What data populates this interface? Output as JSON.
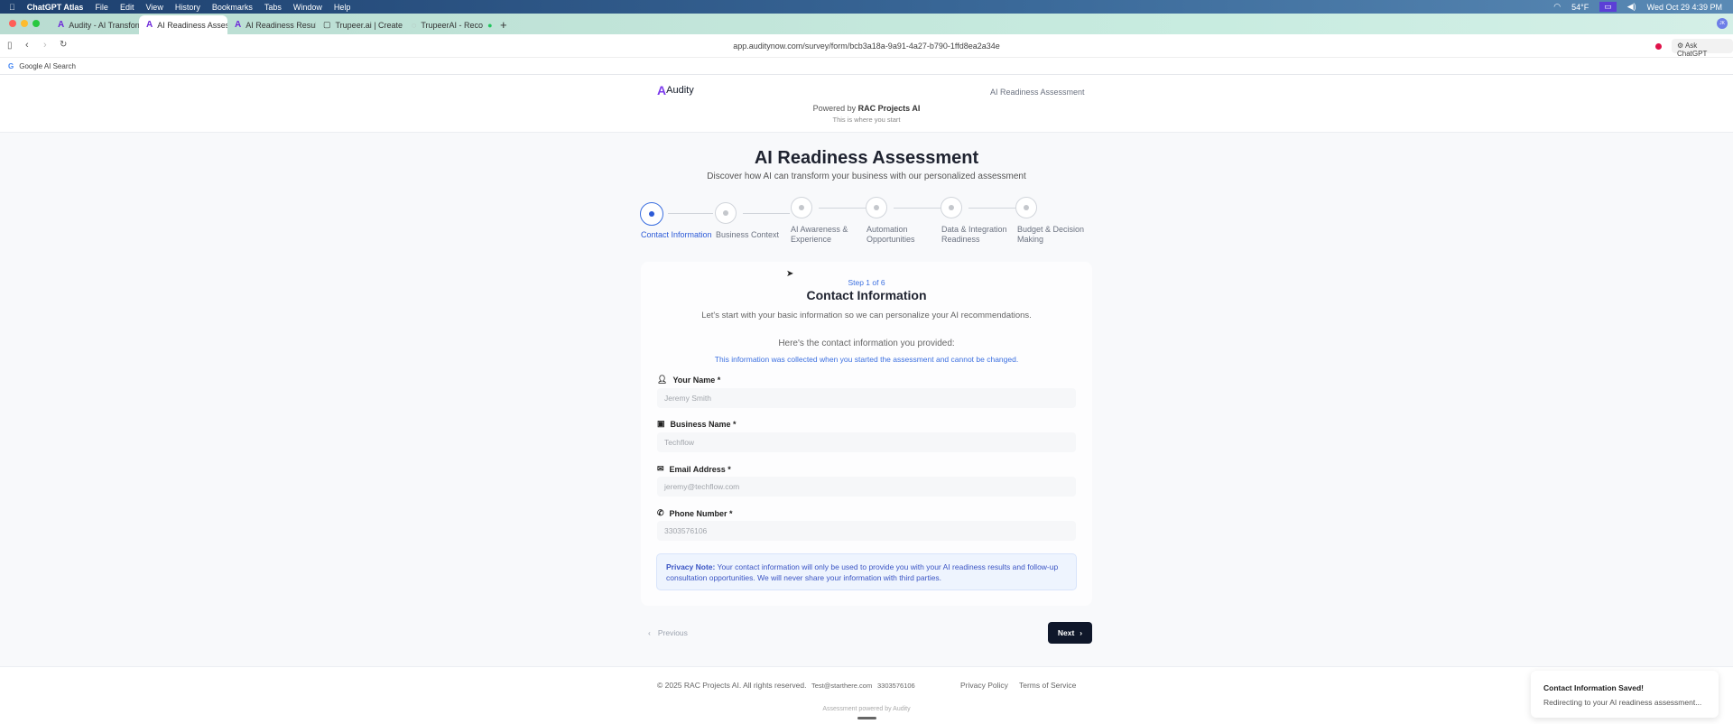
{
  "menubar": {
    "app": "ChatGPT Atlas",
    "items": [
      "File",
      "Edit",
      "View",
      "History",
      "Bookmarks",
      "Tabs",
      "Window",
      "Help"
    ],
    "weather": "54°F",
    "datetime": "Wed Oct 29  4:39 PM"
  },
  "tabs": [
    {
      "label": "Audity - AI Transform"
    },
    {
      "label": "AI Readiness Assess"
    },
    {
      "label": "AI Readiness Results"
    },
    {
      "label": "Trupeer.ai | Create Pr"
    },
    {
      "label": "TrupeerAI - Reco"
    }
  ],
  "toolbar": {
    "url": "app.auditynow.com/survey/form/bcb3a18a-9a91-4a27-b790-1ffd8ea2a34e",
    "ask": "Ask ChatGPT",
    "avatar": "JK"
  },
  "bookmarks": [
    {
      "label": "Google AI Search"
    }
  ],
  "header": {
    "logo": "Audity",
    "right": "AI Readiness Assessment",
    "powered_prefix": "Powered by ",
    "powered_brand": "RAC Projects AI",
    "tagline": "This is where you start"
  },
  "hero": {
    "title": "AI Readiness Assessment",
    "subtitle": "Discover how AI can transform your business with our personalized assessment"
  },
  "steps": [
    {
      "l1": "Contact Information",
      "l2": ""
    },
    {
      "l1": "Business Context",
      "l2": ""
    },
    {
      "l1": "AI Awareness &",
      "l2": "Experience"
    },
    {
      "l1": "Automation",
      "l2": "Opportunities"
    },
    {
      "l1": "Data & Integration",
      "l2": "Readiness"
    },
    {
      "l1": "Budget & Decision",
      "l2": "Making"
    }
  ],
  "form": {
    "step": "Step 1 of 6",
    "title": "Contact Information",
    "desc": "Let's start with your basic information so we can personalize your AI recommendations.",
    "provided": "Here's the contact information you provided:",
    "note": "This information was collected when you started the assessment and cannot be changed.",
    "fields": [
      {
        "label": "Your Name *",
        "value": "Jeremy Smith"
      },
      {
        "label": "Business Name *",
        "value": "Techflow"
      },
      {
        "label": "Email Address *",
        "value": "jeremy@techflow.com"
      },
      {
        "label": "Phone Number *",
        "value": "3303576106"
      }
    ],
    "privacy_title": "Privacy Note:",
    "privacy_text": " Your contact information will only be used to provide you with your AI readiness results and follow-up consultation opportunities. We will never share your information with third parties."
  },
  "nav": {
    "prev": "Previous",
    "next": "Next"
  },
  "footer": {
    "copyright": "© 2025 RAC Projects AI. All rights reserved.",
    "email": "Test@starthere.com",
    "phone": "3303576106",
    "privacy": "Privacy Policy",
    "terms": "Terms of Service",
    "powered": "Assessment powered by Audity"
  },
  "toast": {
    "title": "Contact Information Saved!",
    "text": "Redirecting to your AI readiness assessment..."
  }
}
